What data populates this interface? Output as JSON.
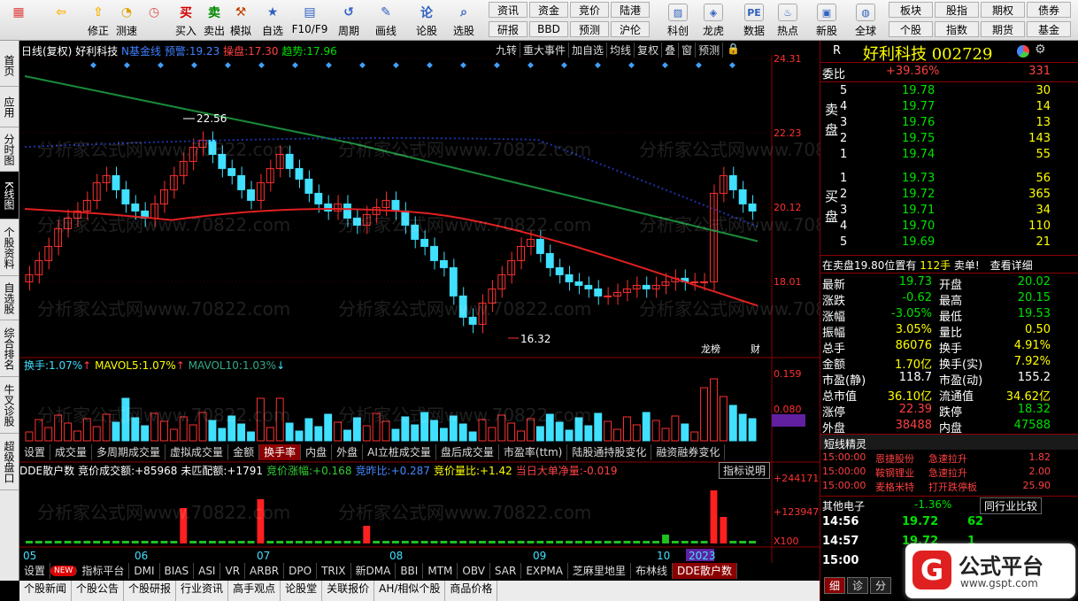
{
  "toolbar": {
    "buttons": [
      {
        "label": "",
        "icon": "grid-icon",
        "color": "#e04040"
      },
      {
        "label": "",
        "icon": "back-arrow-icon",
        "color": "#ffb000"
      },
      {
        "label": "修正",
        "icon": "up-arrow-icon",
        "color": "#ffb000"
      },
      {
        "label": "测速",
        "icon": "refresh-icon",
        "color": "#e0a000"
      },
      {
        "label": "",
        "icon": "clock-icon",
        "color": "#e05050"
      },
      {
        "label": "买入",
        "icon": "buy-icon",
        "color": "#d00000",
        "glyph": "买"
      },
      {
        "label": "卖出",
        "icon": "sell-icon",
        "color": "#008800",
        "glyph": "卖"
      },
      {
        "label": "模拟",
        "icon": "hammer-icon",
        "color": "#c04000"
      },
      {
        "label": "自选",
        "icon": "star-icon",
        "color": "#3060c0"
      },
      {
        "label": "F10/F9",
        "icon": "f10-icon",
        "color": "#3060c0"
      },
      {
        "label": "周期",
        "icon": "period-icon",
        "color": "#3060c0"
      },
      {
        "label": "画线",
        "icon": "pencil-icon",
        "color": "#3060c0"
      },
      {
        "label": "论股",
        "icon": "discuss-icon",
        "color": "#3060c0",
        "glyph": "论"
      },
      {
        "label": "选股",
        "icon": "magnifier-icon",
        "color": "#3060c0"
      }
    ],
    "mini": [
      "资讯",
      "资金",
      "竞价",
      "陆港",
      "研报",
      "BBD",
      "预测",
      "沪伦"
    ],
    "buttons2": [
      {
        "label": "科创",
        "icon": "chart-icon"
      },
      {
        "label": "龙虎",
        "icon": "dragon-icon"
      },
      {
        "label": "数据",
        "icon": "pe-icon"
      },
      {
        "label": "热点",
        "icon": "hot-icon"
      },
      {
        "label": "新股",
        "icon": "ipo-icon"
      },
      {
        "label": "全球",
        "icon": "globe-icon"
      }
    ],
    "mini2": [
      "板块",
      "股指",
      "期权",
      "债券",
      "个股",
      "指数",
      "期货",
      "基金"
    ]
  },
  "sidebar": {
    "tabs": [
      "首页",
      "应用",
      "分时图",
      "K线图",
      "个股资料",
      "自选股",
      "综合排名",
      "牛叉诊股",
      "超级盘口"
    ],
    "active": "K线图"
  },
  "chart": {
    "header": {
      "period": "日线(复权)",
      "name": "好利科技",
      "indicator": "N基金线",
      "ydz_label": "预警:",
      "ydz_value": "19.23",
      "cp_label": "操盘:",
      "cp_value": "17.30",
      "qs_label": "趋势:",
      "qs_value": "17.96"
    },
    "top_buttons": [
      "九转",
      "重大事件",
      "加自选",
      "均线",
      "复权",
      "叠",
      "窗",
      "预测"
    ],
    "price_axis": [
      "24.31",
      "22.23",
      "20.12",
      "18.01"
    ],
    "high_label": "22.56",
    "low_label": "16.32",
    "vol_header": {
      "label": "换手:",
      "value": "1.07%",
      "ma5_label": "MAVOL5:",
      "ma5": "1.07%",
      "ma10_label": "MAVOL10:",
      "ma10": "1.03%"
    },
    "vol_axis": [
      "0.159",
      "0.080",
      "0.050"
    ],
    "vol_tabs": [
      "设置",
      "成交量",
      "多周期成交量",
      "虚拟成交量",
      "金额",
      "换手率",
      "内盘",
      "外盘",
      "AI立桩成交量",
      "盘后成交量",
      "市盈率(ttm)",
      "陆股通持股变化",
      "融资融券变化"
    ],
    "dde_header": {
      "name": "DDE散户数",
      "items": [
        {
          "label": "竞价成交额:",
          "value": "+85968"
        },
        {
          "label": "未匹配额:",
          "value": "+1791"
        },
        {
          "label": "竞价涨幅:",
          "value": "+0.168"
        },
        {
          "label": "竞昨比:",
          "value": "+0.287"
        },
        {
          "label": "竞价量比:",
          "value": "+1.42"
        },
        {
          "label": "当日大单净量:",
          "value": "-0.019"
        }
      ],
      "explain": "指标说明"
    },
    "dde_axis": [
      "+244171",
      "+123947",
      "X100"
    ],
    "months": [
      "05",
      "06",
      "07",
      "08",
      "09",
      "10",
      "2023"
    ],
    "bottom_tabs": [
      "设置",
      "指标平台",
      "DMI",
      "BIAS",
      "ASI",
      "VR",
      "ARBR",
      "DPO",
      "TRIX",
      "新DMA",
      "BBI",
      "MTM",
      "OBV",
      "SAR",
      "EXPMA",
      "芝麻里地里",
      "布林线",
      "DDE散户数"
    ],
    "bottom_tabs2": [
      "个股新闻",
      "个股公告",
      "个股研报",
      "行业资讯",
      "高手观点",
      "论股堂",
      "关联报价",
      "AH/相似个股",
      "商品价格"
    ],
    "tags": [
      "龙榜",
      "财"
    ],
    "new_badge": "NEW",
    "watermark": "分析家公式网www.70822.com"
  },
  "quote": {
    "title": "好利科技 002729",
    "r_label": "R",
    "weibi_label": "委比",
    "weibi_pct": "+39.36%",
    "weibi_val": "331",
    "sell": [
      {
        "lvl": "5",
        "price": "19.78",
        "vol": "30"
      },
      {
        "lvl": "4",
        "price": "19.77",
        "vol": "14"
      },
      {
        "lvl": "3",
        "price": "19.76",
        "vol": "13"
      },
      {
        "lvl": "2",
        "price": "19.75",
        "vol": "143"
      },
      {
        "lvl": "1",
        "price": "19.74",
        "vol": "55"
      }
    ],
    "buy": [
      {
        "lvl": "1",
        "price": "19.73",
        "vol": "56"
      },
      {
        "lvl": "2",
        "price": "19.72",
        "vol": "365"
      },
      {
        "lvl": "3",
        "price": "19.71",
        "vol": "34"
      },
      {
        "lvl": "4",
        "price": "19.70",
        "vol": "110"
      },
      {
        "lvl": "5",
        "price": "19.69",
        "vol": "21"
      }
    ],
    "sell_side": "卖盘",
    "buy_side": "买盘",
    "notice": "在卖盘19.80位置有",
    "notice_vol": "112手",
    "notice_txt": "卖单!",
    "notice_link": "查看详细",
    "stats": [
      {
        "l": "最新",
        "lv": "19.73",
        "r": "开盘",
        "rv": "20.02",
        "lc": "grn",
        "rc": "grn"
      },
      {
        "l": "涨跌",
        "lv": "-0.62",
        "r": "最高",
        "rv": "20.15",
        "lc": "grn",
        "rc": "grn"
      },
      {
        "l": "涨幅",
        "lv": "-3.05%",
        "r": "最低",
        "rv": "19.53",
        "lc": "grn",
        "rc": "grn"
      },
      {
        "l": "振幅",
        "lv": "3.05%",
        "r": "量比",
        "rv": "0.50",
        "lc": "yel",
        "rc": "yel"
      },
      {
        "l": "总手",
        "lv": "86076",
        "r": "换手",
        "rv": "4.91%",
        "lc": "yel",
        "rc": "yel"
      },
      {
        "l": "金额",
        "lv": "1.70亿",
        "r": "换手(实)",
        "rv": "7.92%",
        "lc": "yel",
        "rc": "yel"
      },
      {
        "l": "市盈(静)",
        "lv": "118.7",
        "r": "市盈(动)",
        "rv": "155.2",
        "lc": "wht",
        "rc": "wht"
      },
      {
        "l": "总市值",
        "lv": "36.10亿",
        "r": "流通值",
        "rv": "34.62亿",
        "lc": "yel",
        "rc": "yel"
      },
      {
        "l": "涨停",
        "lv": "22.39",
        "r": "跌停",
        "rv": "18.32",
        "lc": "red",
        "rc": "grn"
      },
      {
        "l": "外盘",
        "lv": "38488",
        "r": "内盘",
        "rv": "47588",
        "lc": "red",
        "rc": "grn"
      }
    ],
    "short_title": "短线精灵",
    "short": [
      {
        "t": "15:00:00",
        "n": "恩捷股份",
        "e": "急速拉升",
        "v": "1.82"
      },
      {
        "t": "15:00:00",
        "n": "鞍钢锂业",
        "e": "急速拉升",
        "v": "2.00"
      },
      {
        "t": "15:00:00",
        "n": "麦格米特",
        "e": "打开跌停板",
        "v": "25.90"
      }
    ],
    "sector": "其他电子",
    "sector_pct": "-1.36%",
    "sector_cmp": "同行业比较",
    "ticks": [
      {
        "t": "14:56",
        "p": "19.72",
        "v": "62"
      },
      {
        "t": "14:57",
        "p": "19.72",
        "v": "1"
      },
      {
        "t": "15:00",
        "p": "",
        "v": ""
      }
    ],
    "tabs": [
      "细",
      "诊",
      "分"
    ],
    "brand": "公式平台",
    "brand_url": "www.gspt.com"
  },
  "colors": {
    "up": "#ff3030",
    "down": "#40e0ff",
    "ma_red": "#e02020",
    "ma_green": "#1a8a3a",
    "dot": "#2030a0"
  }
}
